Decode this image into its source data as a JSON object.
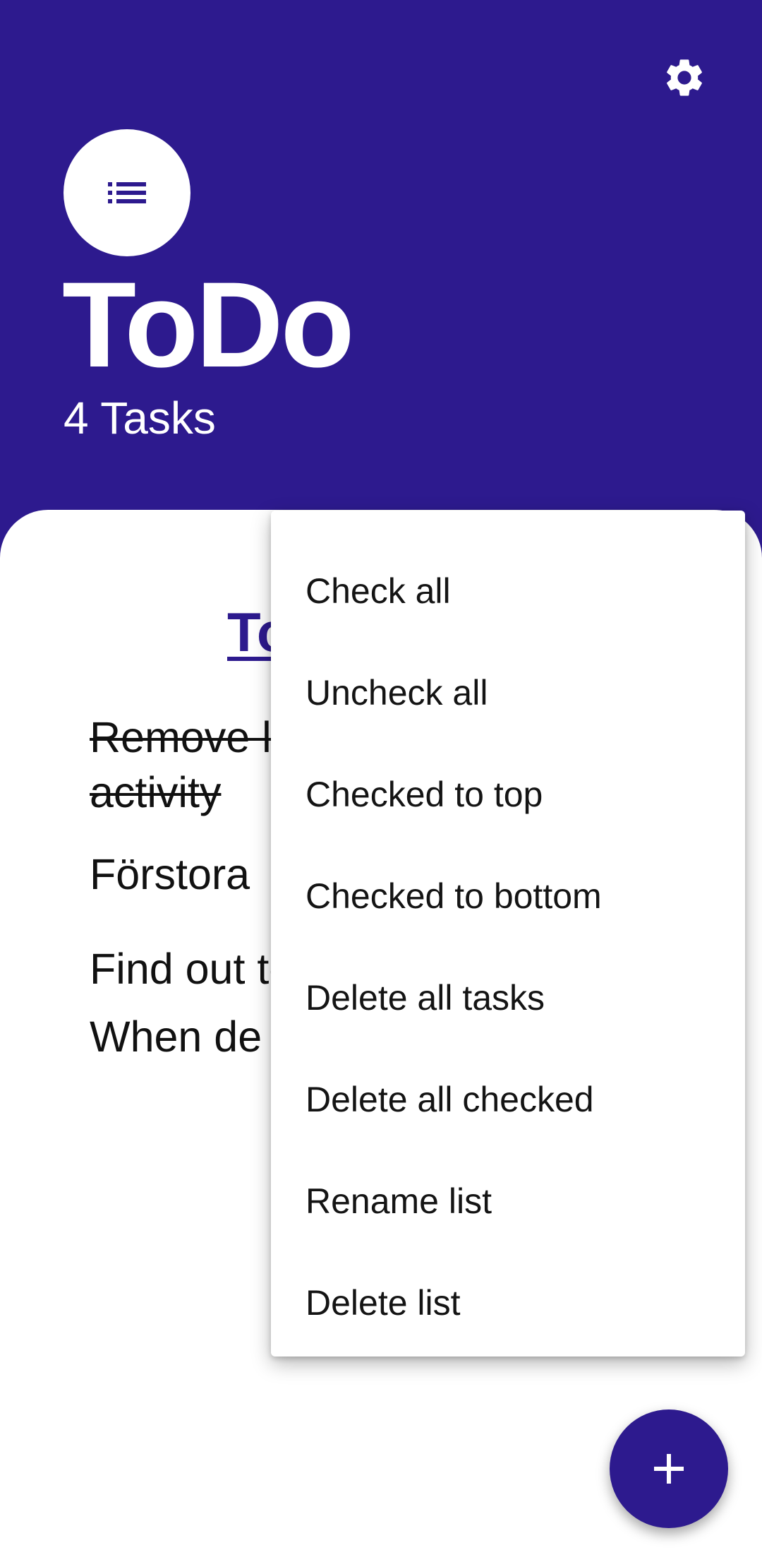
{
  "header": {
    "title": "ToDo",
    "task_count": "4 Tasks",
    "settings_icon": "gear-icon",
    "avatar_icon": "list-icon"
  },
  "list": {
    "title_visible": "To",
    "tasks": [
      {
        "text": "Remove list when backup activity",
        "checked": true
      },
      {
        "text": "Förstora",
        "checked": false
      },
      {
        "text": "Find out text field search er",
        "checked": false
      },
      {
        "text": "When de still see i change list",
        "checked": false
      }
    ]
  },
  "menu": {
    "items": [
      "Check all",
      "Uncheck all",
      "Checked to top",
      "Checked to bottom",
      "Delete all tasks",
      "Delete all checked",
      "Rename list",
      "Delete list"
    ]
  },
  "fab": {
    "icon": "plus-icon"
  },
  "colors": {
    "primary": "#2d1a8e",
    "surface": "#ffffff",
    "text": "#111111"
  }
}
